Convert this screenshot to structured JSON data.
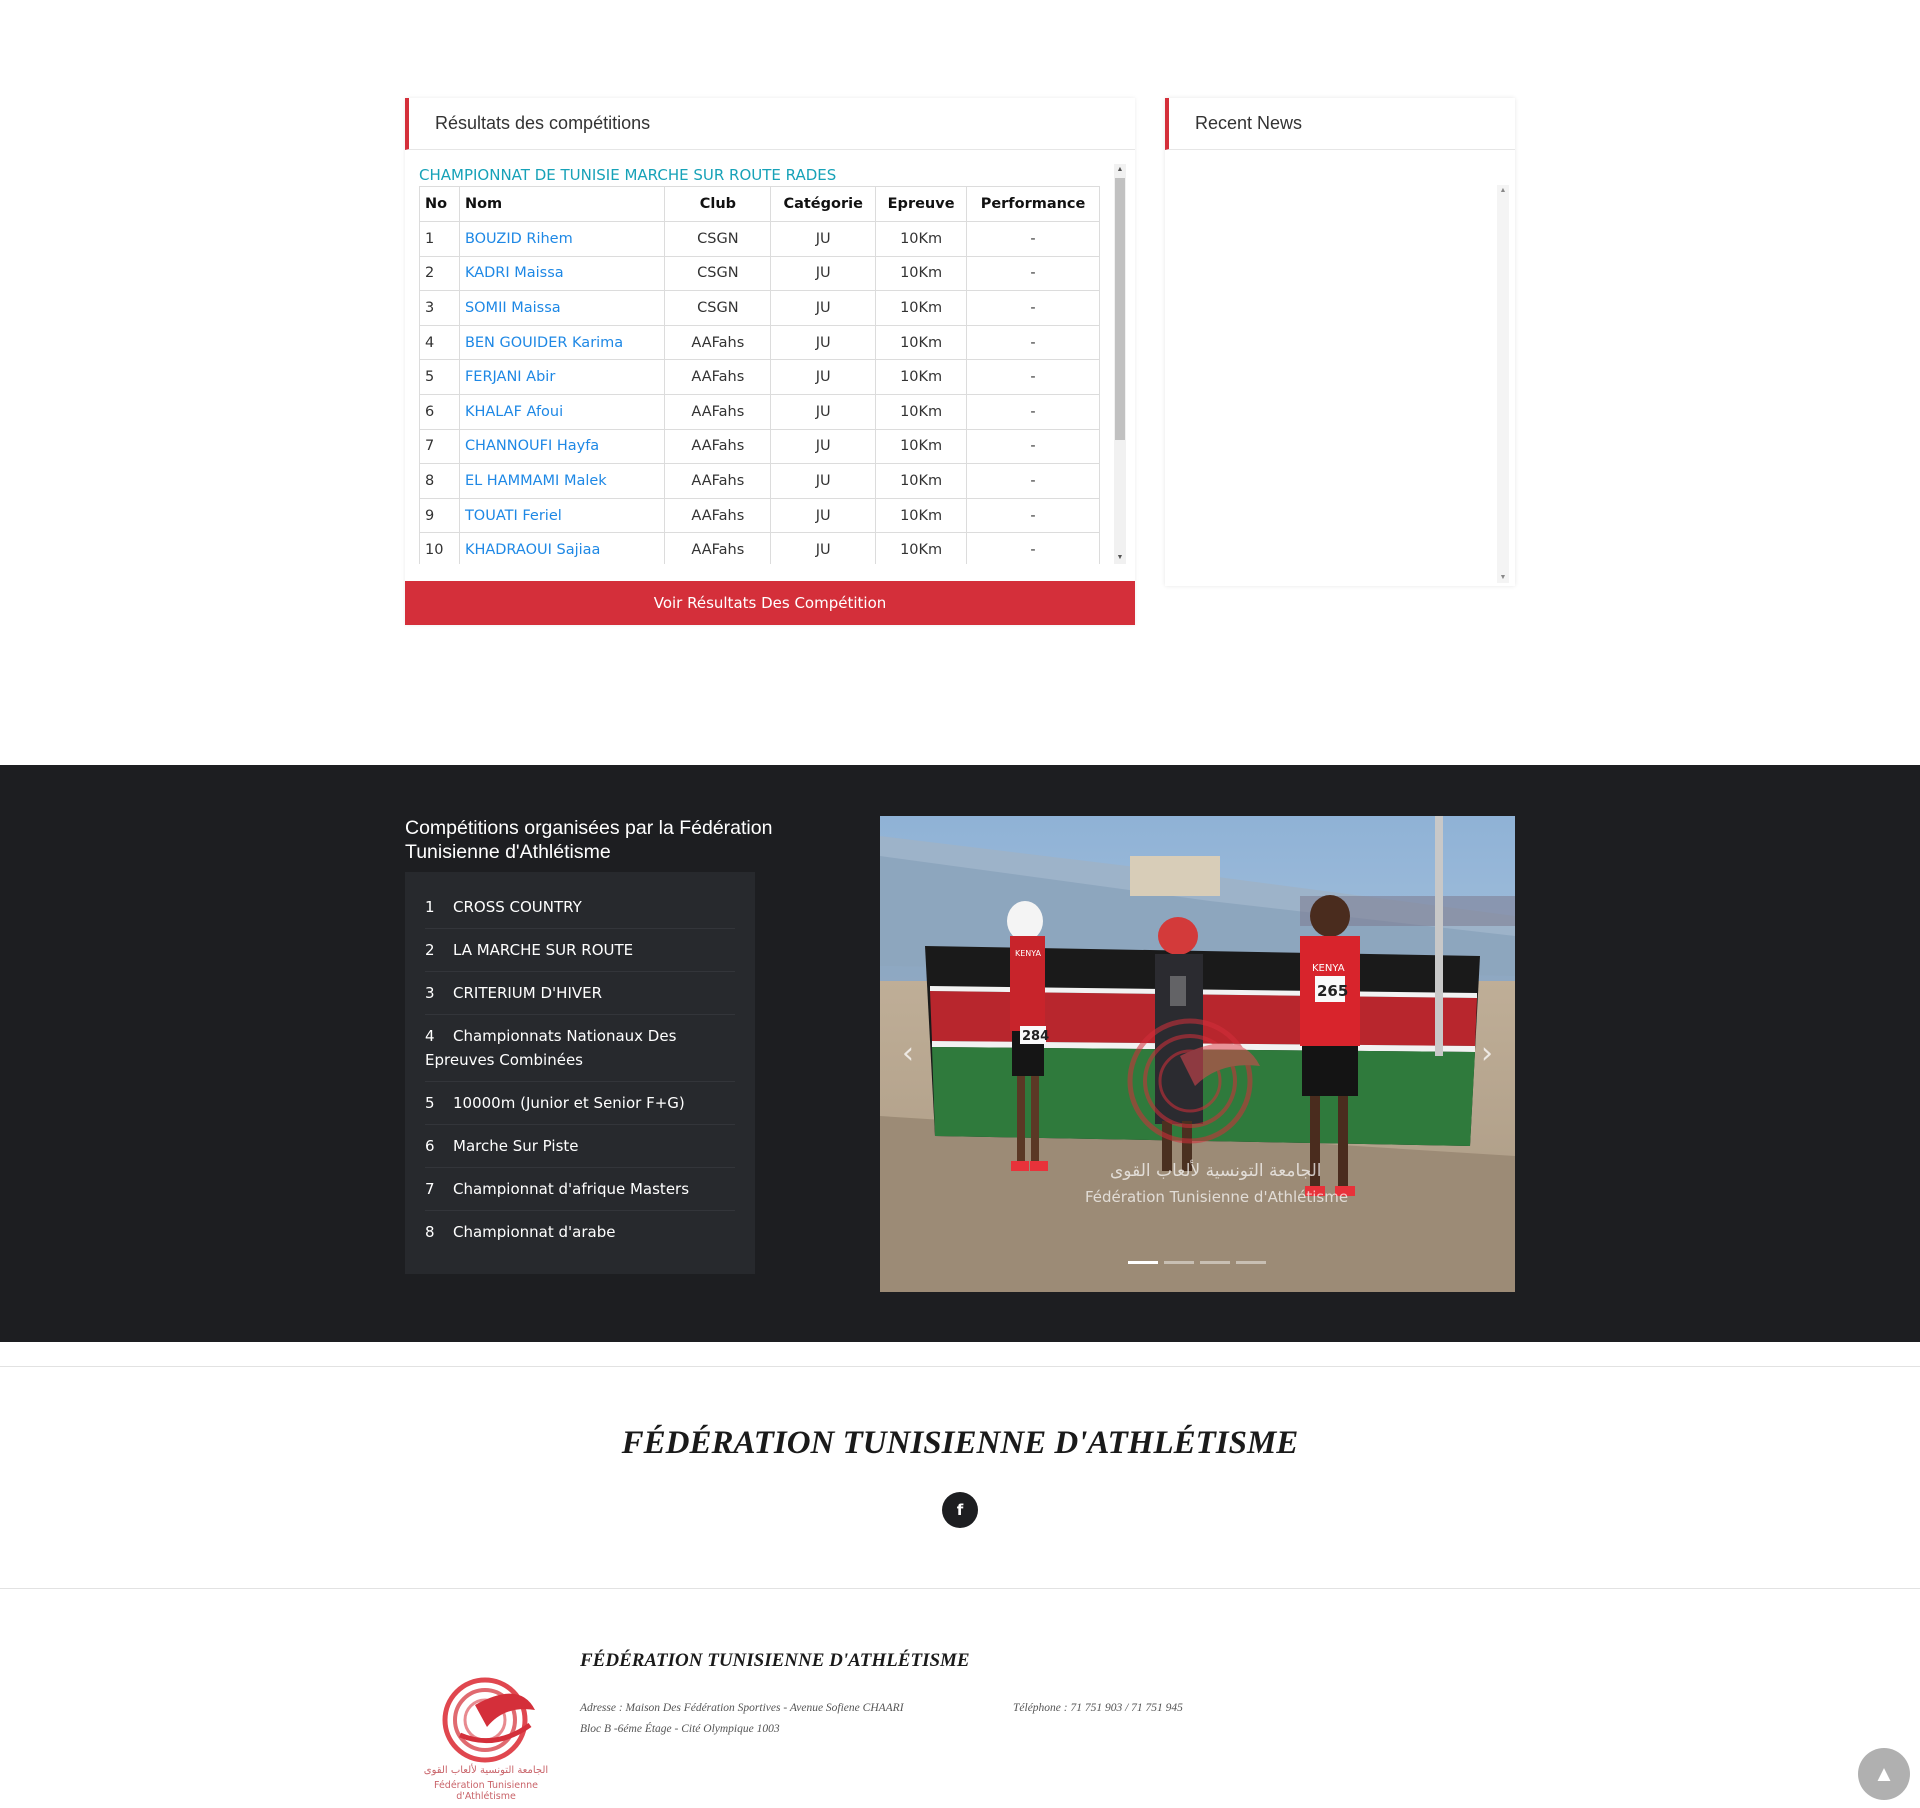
{
  "results": {
    "panel_title": "Résultats des compétitions",
    "competition_title": "CHAMPIONNAT DE TUNISIE MARCHE SUR ROUTE RADES",
    "columns": [
      "No",
      "Nom",
      "Club",
      "Catégorie",
      "Epreuve",
      "Performance"
    ],
    "rows": [
      {
        "no": "1",
        "nom": "BOUZID Rihem",
        "club": "CSGN",
        "categorie": "JU",
        "epreuve": "10Km",
        "performance": "-"
      },
      {
        "no": "2",
        "nom": "KADRI Maissa",
        "club": "CSGN",
        "categorie": "JU",
        "epreuve": "10Km",
        "performance": "-"
      },
      {
        "no": "3",
        "nom": "SOMII Maissa",
        "club": "CSGN",
        "categorie": "JU",
        "epreuve": "10Km",
        "performance": "-"
      },
      {
        "no": "4",
        "nom": "BEN GOUIDER Karima",
        "club": "AAFahs",
        "categorie": "JU",
        "epreuve": "10Km",
        "performance": "-"
      },
      {
        "no": "5",
        "nom": "FERJANI Abir",
        "club": "AAFahs",
        "categorie": "JU",
        "epreuve": "10Km",
        "performance": "-"
      },
      {
        "no": "6",
        "nom": "KHALAF Afoui",
        "club": "AAFahs",
        "categorie": "JU",
        "epreuve": "10Km",
        "performance": "-"
      },
      {
        "no": "7",
        "nom": "CHANNOUFI Hayfa",
        "club": "AAFahs",
        "categorie": "JU",
        "epreuve": "10Km",
        "performance": "-"
      },
      {
        "no": "8",
        "nom": "EL HAMMAMI Malek",
        "club": "AAFahs",
        "categorie": "JU",
        "epreuve": "10Km",
        "performance": "-"
      },
      {
        "no": "9",
        "nom": "TOUATI Feriel",
        "club": "AAFahs",
        "categorie": "JU",
        "epreuve": "10Km",
        "performance": "-"
      },
      {
        "no": "10",
        "nom": "KHADRAOUI Sajiaa",
        "club": "AAFahs",
        "categorie": "JU",
        "epreuve": "10Km",
        "performance": "-"
      }
    ],
    "button_label": "Voir Résultats Des Compétition"
  },
  "news": {
    "panel_title": "Recent News"
  },
  "competitions": {
    "heading": "Compétitions organisées par la Fédération Tunisienne d'Athlétisme",
    "items": [
      {
        "num": "1",
        "label": "CROSS COUNTRY"
      },
      {
        "num": "2",
        "label": "LA MARCHE SUR ROUTE"
      },
      {
        "num": "3",
        "label": "CRITERIUM D'HIVER"
      },
      {
        "num": "4",
        "label": "Championnats Nationaux Des Epreuves Combinées"
      },
      {
        "num": "5",
        "label": "10000m (Junior et Senior F+G)"
      },
      {
        "num": "6",
        "label": "Marche Sur Piste"
      },
      {
        "num": "7",
        "label": "Championnat d'afrique Masters"
      },
      {
        "num": "8",
        "label": "Championnat d'arabe"
      }
    ]
  },
  "slider": {
    "bib_left": "284",
    "bib_right": "265",
    "shirt_text": "KENYA",
    "watermark_ar": "الجامعة التونسية لألعاب القوى",
    "watermark_fr": "Fédération Tunisienne d'Athlétisme",
    "slide_count": 4,
    "active_slide": 1,
    "prev_icon": "‹",
    "next_icon": "›"
  },
  "footer": {
    "title": "FÉDÉRATION TUNISIENNE D'ATHLÉTISME",
    "facebook_icon": "f",
    "logo_ar": "الجامعة التونسية لألعاب القوى",
    "logo_fr": "Fédération Tunisienne d'Athlétisme",
    "small_title": "FÉDÉRATION TUNISIENNE D'ATHLÉTISME",
    "address_line1": "Adresse : Maison Des Fédération Sportives - Avenue Sofiene CHAARI",
    "address_line2": "Bloc B -6éme Étage - Cité Olympique 1003",
    "telephone": "Téléphone : 71 751 903 / 71 751 945",
    "back_to_top_icon": "▲"
  },
  "colors": {
    "accent_red": "#d42f3a",
    "link_blue": "#1e88e5",
    "competition_teal": "#17a2b8",
    "dark_bg": "#1d1e21"
  }
}
